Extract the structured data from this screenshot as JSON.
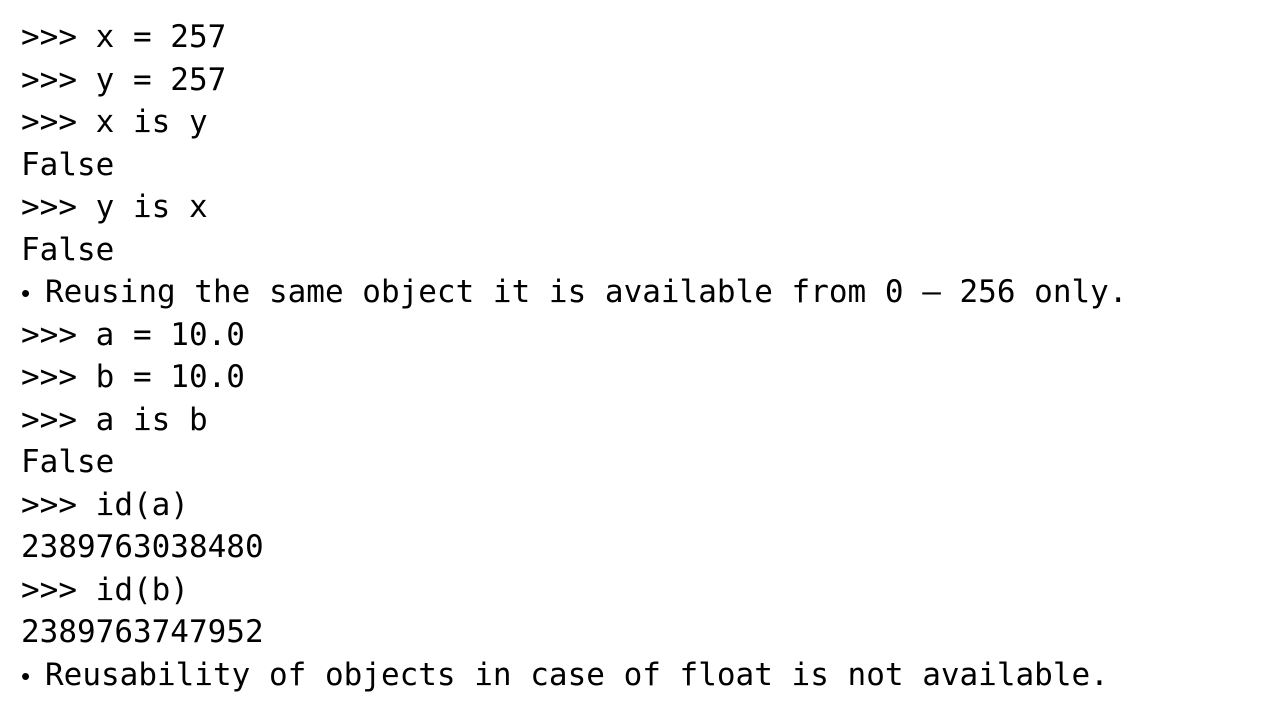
{
  "lines": [
    {
      "kind": "code",
      "text": ">>> x = 257"
    },
    {
      "kind": "code",
      "text": ">>> y = 257"
    },
    {
      "kind": "code",
      "text": ">>> x is y"
    },
    {
      "kind": "code",
      "text": "False"
    },
    {
      "kind": "code",
      "text": ">>> y is x"
    },
    {
      "kind": "code",
      "text": "False"
    },
    {
      "kind": "bullet",
      "bullet": "•",
      "text": "Reusing the same object it is available from 0 – 256 only."
    },
    {
      "kind": "code",
      "text": ">>> a = 10.0"
    },
    {
      "kind": "code",
      "text": ">>> b = 10.0"
    },
    {
      "kind": "code",
      "text": ">>> a is b"
    },
    {
      "kind": "code",
      "text": "False"
    },
    {
      "kind": "code",
      "text": ">>> id(a)"
    },
    {
      "kind": "code",
      "text": "2389763038480"
    },
    {
      "kind": "code",
      "text": ">>> id(b)"
    },
    {
      "kind": "code",
      "text": "2389763747952"
    },
    {
      "kind": "bullet",
      "bullet": "•",
      "text": "Reusability of objects in case of float is not available."
    }
  ]
}
